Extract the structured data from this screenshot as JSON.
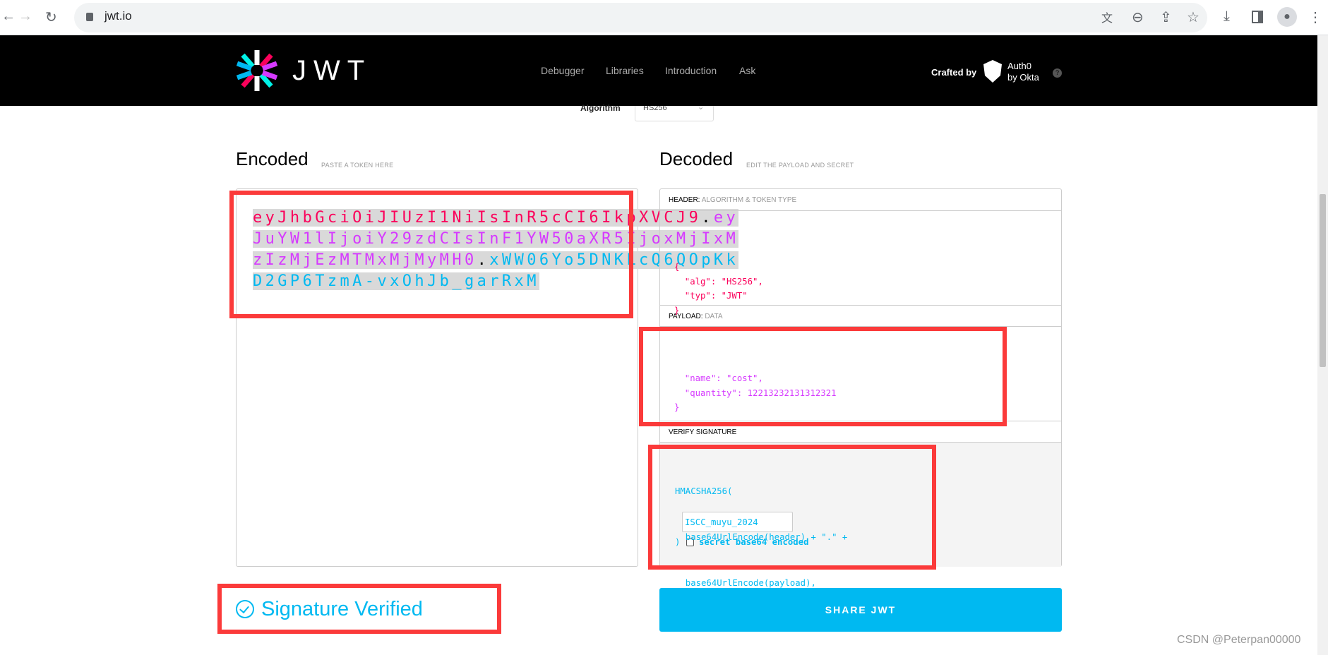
{
  "browser": {
    "url": "jwt.io",
    "icons": [
      "back-icon",
      "forward-icon",
      "reload-icon",
      "lock-icon",
      "translate-icon",
      "zoom-icon",
      "share-icon",
      "star-icon",
      "download-icon",
      "sidepanel-icon",
      "profile-icon",
      "menu-icon"
    ]
  },
  "nav": {
    "logo_text": "JWT",
    "links": [
      "Debugger",
      "Libraries",
      "Introduction",
      "Ask"
    ],
    "crafted_by": "Crafted by",
    "auth0_line1": "Auth0",
    "auth0_line2": "by Okta"
  },
  "algorithm": {
    "label": "Algorithm",
    "value": "HS256"
  },
  "encoded": {
    "title": "Encoded",
    "subtitle": "PASTE A TOKEN HERE",
    "header_part": "eyJhbGciOiJIUzI1NiIsInR5cCI6IkpXVCJ9",
    "payload_part": "eyJuYW1lIjoiY29zdCIsInF1YW50aXR5IjoxMjIxMzIzMjEzMTMxMjMyMH0",
    "signature_part": "xWW06Yo5DNKLcQ6QOpKkD2GP6TzmA-vxOhJb_garRxM",
    "lines": [
      [
        "eyJhbGciOiJIUzI1NiIsInR5cCI6IkpXVCJ9",
        ".",
        "ey"
      ],
      [
        "JuYW1lIjoiY29zdCIsInF1YW50aXR5IjoxMjIxM"
      ],
      [
        "zIzMjEzMTMxMjMyMH0",
        ".",
        "xWW06Yo5DNKLcQ6QOpKk"
      ],
      [
        "D2GP6TzmA-vxOhJb_garRxM"
      ]
    ]
  },
  "decoded": {
    "title": "Decoded",
    "subtitle": "EDIT THE PAYLOAD AND SECRET",
    "header": {
      "label": "HEADER:",
      "sublabel": "ALGORITHM & TOKEN TYPE",
      "lines": [
        "{",
        "  \"alg\": \"HS256\",",
        "  \"typ\": \"JWT\"",
        "}"
      ]
    },
    "payload": {
      "label": "PAYLOAD:",
      "sublabel": "DATA",
      "lines": [
        "  \"name\": \"cost\",",
        "  \"quantity\": 12213232131312321",
        "}"
      ]
    },
    "verify": {
      "label": "VERIFY SIGNATURE",
      "line1": "HMACSHA256(",
      "line2": "  base64UrlEncode(header) + \".\" +",
      "line3": "  base64UrlEncode(payload),",
      "secret": "ISCC_muyu_2024",
      "close": ")",
      "checkbox_label": "secret base64 encoded",
      "checked": false
    }
  },
  "status": {
    "text": "Signature Verified"
  },
  "share_button": "SHARE JWT",
  "watermark": "CSDN @Peterpan00000",
  "colors": {
    "header": "#fb015b",
    "payload": "#d63aff",
    "signature": "#00b9f1",
    "button": "#00b9f1",
    "annotation": "#fb3a3a"
  }
}
